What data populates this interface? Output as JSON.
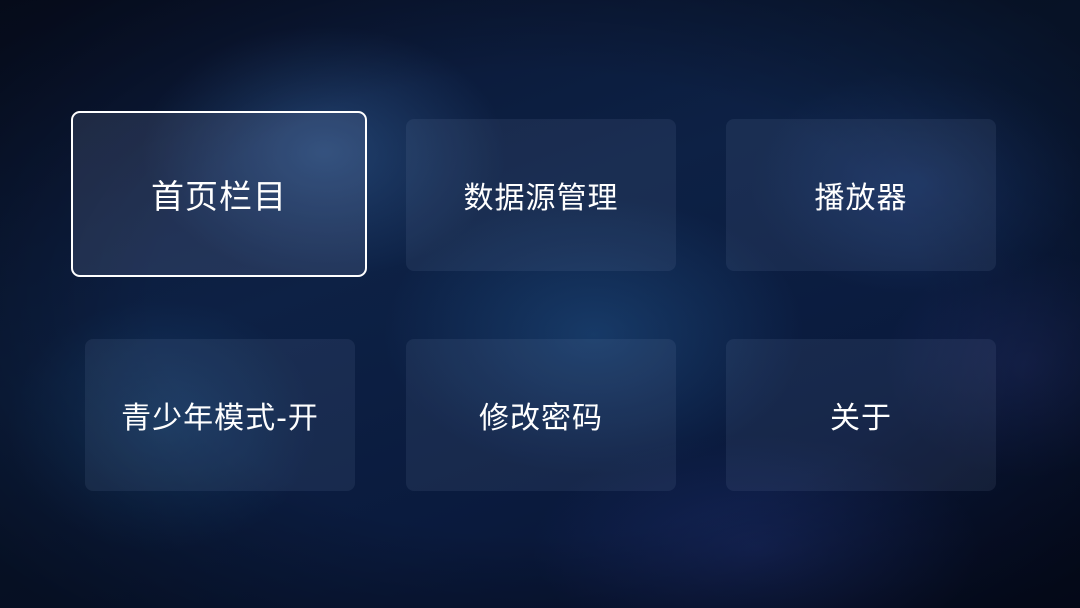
{
  "settings_menu": {
    "items": [
      {
        "label": "首页栏目",
        "focused": true
      },
      {
        "label": "数据源管理",
        "focused": false
      },
      {
        "label": "播放器",
        "focused": false
      },
      {
        "label": "青少年模式-开",
        "focused": false
      },
      {
        "label": "修改密码",
        "focused": false
      },
      {
        "label": "关于",
        "focused": false
      }
    ]
  },
  "colors": {
    "focus_border": "#ffffff",
    "text": "#ffffff",
    "background": "#0b1633"
  }
}
